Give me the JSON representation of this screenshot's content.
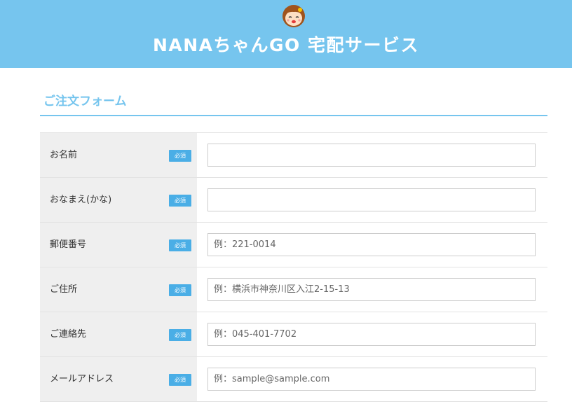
{
  "header": {
    "title": "NANAちゃんGO 宅配サービス",
    "mascot_icon": "girl-mascot-icon",
    "bg_color": "#76c5ee"
  },
  "form": {
    "section_title": "ご注文フォーム",
    "required_label": "必須",
    "fields": [
      {
        "label": "お名前",
        "placeholder": ""
      },
      {
        "label": "おなまえ(かな)",
        "placeholder": ""
      },
      {
        "label": "郵便番号",
        "placeholder": "例：221-0014"
      },
      {
        "label": "ご住所",
        "placeholder": "例：横浜市神奈川区入江2-15-13"
      },
      {
        "label": "ご連絡先",
        "placeholder": "例：045-401-7702"
      },
      {
        "label": "メールアドレス",
        "placeholder": "例：sample@sample.com"
      }
    ]
  },
  "colors": {
    "accent": "#76c5ee",
    "badge": "#4aaee6",
    "label_bg": "#efefef"
  }
}
